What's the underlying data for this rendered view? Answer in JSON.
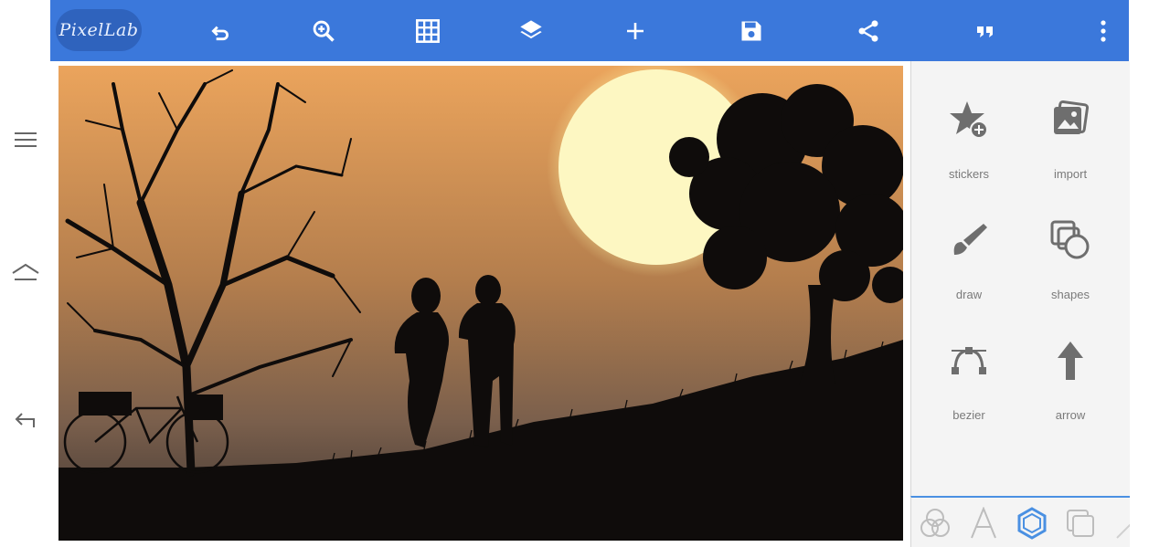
{
  "app": {
    "logo_text": "PixelLab"
  },
  "colors": {
    "accent": "#3b78db",
    "tab_active": "#4a90e2",
    "panel_bg": "#f4f4f4",
    "label": "#7a7a7a"
  },
  "system_nav": [
    "menu-icon",
    "home-icon",
    "back-icon"
  ],
  "toolbar": [
    "undo-icon",
    "zoom-icon",
    "grid-icon",
    "layers-icon",
    "add-icon",
    "save-icon",
    "share-icon",
    "quote-icon",
    "more-vert-icon"
  ],
  "tools": [
    {
      "label": "stickers",
      "icon": "star-plus-icon"
    },
    {
      "label": "import",
      "icon": "image-import-icon"
    },
    {
      "label": "draw",
      "icon": "brush-icon"
    },
    {
      "label": "shapes",
      "icon": "shapes-icon"
    },
    {
      "label": "bezier",
      "icon": "bezier-icon"
    },
    {
      "label": "arrow",
      "icon": "arrow-up-icon"
    }
  ],
  "bottom_tabs": [
    "blend-icon",
    "text-icon",
    "shape-hexagon-icon",
    "duplicate-icon",
    "more-icon"
  ],
  "active_bottom_tab": "shape-hexagon-icon"
}
